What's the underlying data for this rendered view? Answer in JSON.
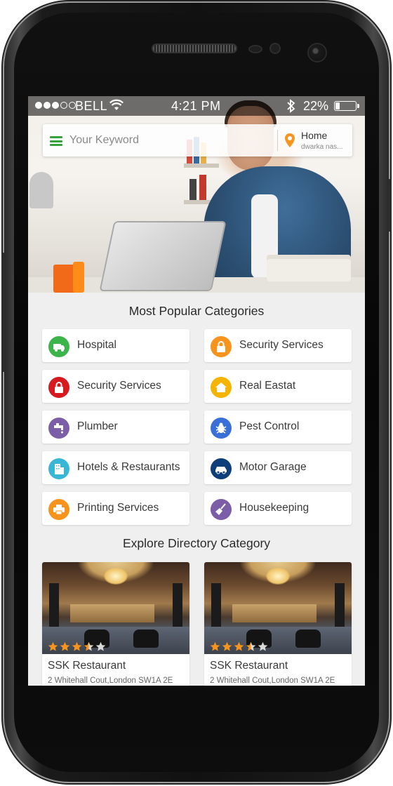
{
  "status_bar": {
    "carrier": "BELL",
    "time": "4:21 PM",
    "battery_percent_label": "22%",
    "battery_level": 0.22,
    "signal_dots_filled": 3,
    "signal_dots_total": 5
  },
  "search": {
    "placeholder": "Your Keyword",
    "location_title": "Home",
    "location_subtitle": "dwarka nas..."
  },
  "sections": {
    "popular_title": "Most Popular Categories",
    "explore_title": "Explore Directory Category"
  },
  "categories": [
    {
      "label": "Hospital",
      "icon": "ambulance-icon",
      "color": "#3bb54a"
    },
    {
      "label": "Security Services",
      "icon": "lock-icon",
      "color": "#f7941d"
    },
    {
      "label": "Security Services",
      "icon": "lock-icon",
      "color": "#d71920"
    },
    {
      "label": "Real Eastat",
      "icon": "home-icon",
      "color": "#f4b400"
    },
    {
      "label": "Plumber",
      "icon": "faucet-icon",
      "color": "#7b5ea7"
    },
    {
      "label": "Pest Control",
      "icon": "bug-icon",
      "color": "#3a6fd8"
    },
    {
      "label": "Hotels & Restaurants",
      "icon": "building-icon",
      "color": "#38b6d6"
    },
    {
      "label": "Motor Garage",
      "icon": "car-icon",
      "color": "#0f3f7a"
    },
    {
      "label": "Printing Services",
      "icon": "printer-icon",
      "color": "#f7941d"
    },
    {
      "label": "Housekeeping",
      "icon": "broom-icon",
      "color": "#7b5ea7"
    }
  ],
  "directory": [
    {
      "name": "SSK Restaurant",
      "address": "2 Whitehall Cout,London SW1A 2E",
      "rating": 3.5,
      "rating_max": 5
    },
    {
      "name": "SSK Restaurant",
      "address": "2 Whitehall Cout,London SW1A 2E",
      "rating": 3.5,
      "rating_max": 5
    }
  ],
  "colors": {
    "accent_green": "#36a23c",
    "star_orange": "#f7941d",
    "star_empty": "#d9d9d9",
    "location_pin": "#f7941d"
  }
}
